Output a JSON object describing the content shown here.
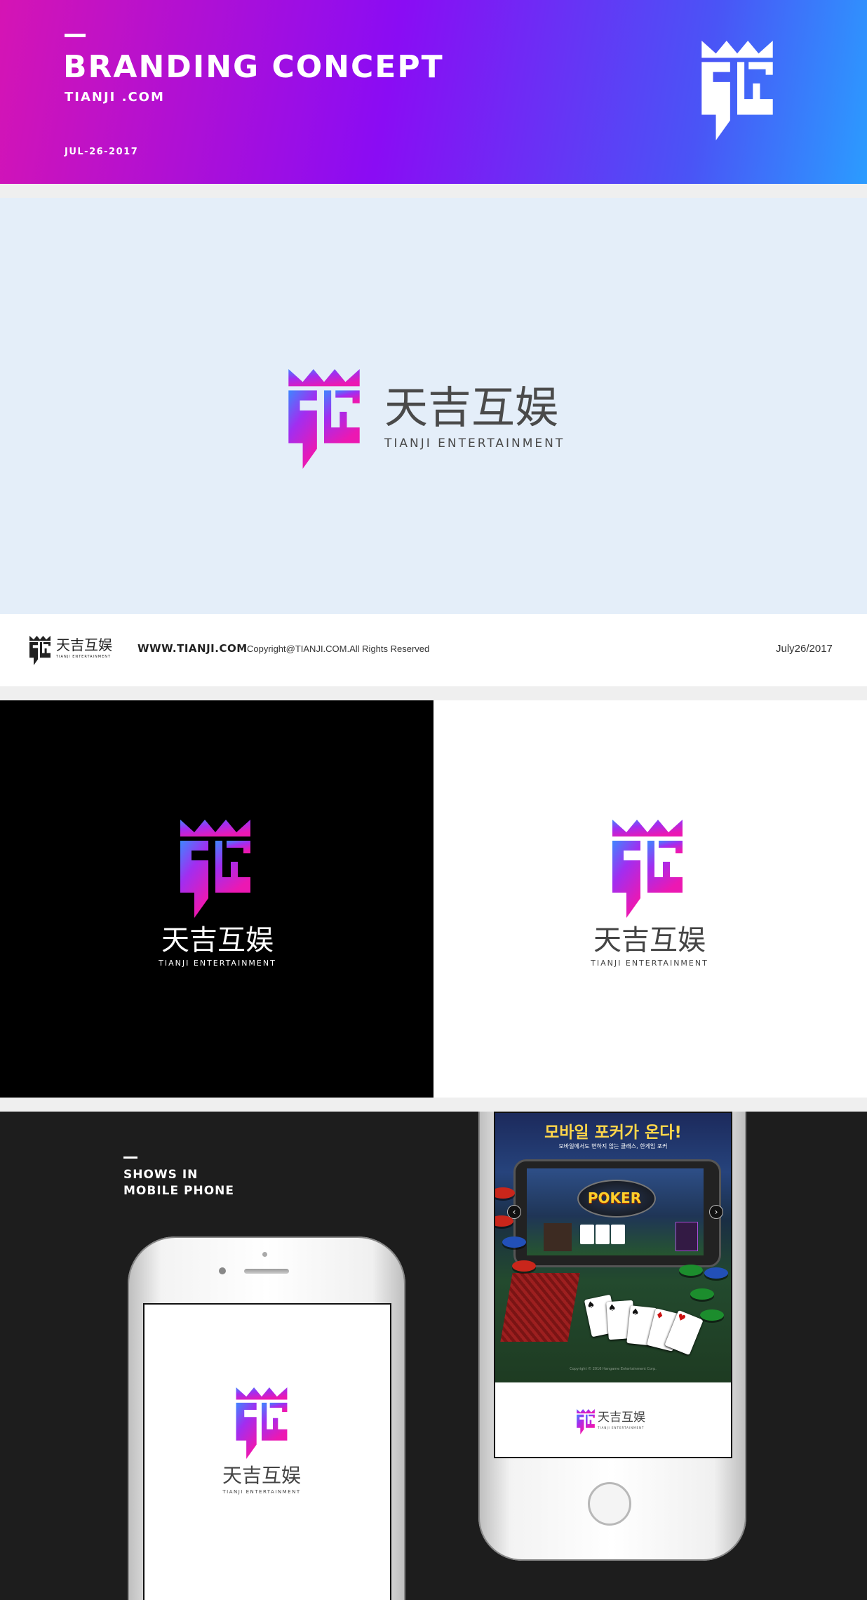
{
  "header": {
    "title": "BRANDING CONCEPT",
    "site": "TIANJI .COM",
    "date": "JUL-26-2017"
  },
  "brand": {
    "name_cn": "天吉互娱",
    "name_en": "TIANJI ENTERTAINMENT",
    "colors": {
      "magenta": "#e019b8",
      "violet": "#7c2cf2",
      "blue": "#2f8cff"
    }
  },
  "footer": {
    "url": "WWW.TIANJI.COM",
    "copyright": "Copyright@TIANJI.COM.All Rights Reserved",
    "date": "July26/2017"
  },
  "mobile": {
    "title_line1": "SHOWS IN",
    "title_line2": "MOBILE PHONE"
  },
  "game_screen": {
    "headline": "모바일 포커가 온다!",
    "subline": "모바일에서도 변하지 않는 클래스, 한게임 포커",
    "poker_label": "POKER",
    "copyright": "Copyright © 2016 Hangame Entertainment Corp."
  }
}
